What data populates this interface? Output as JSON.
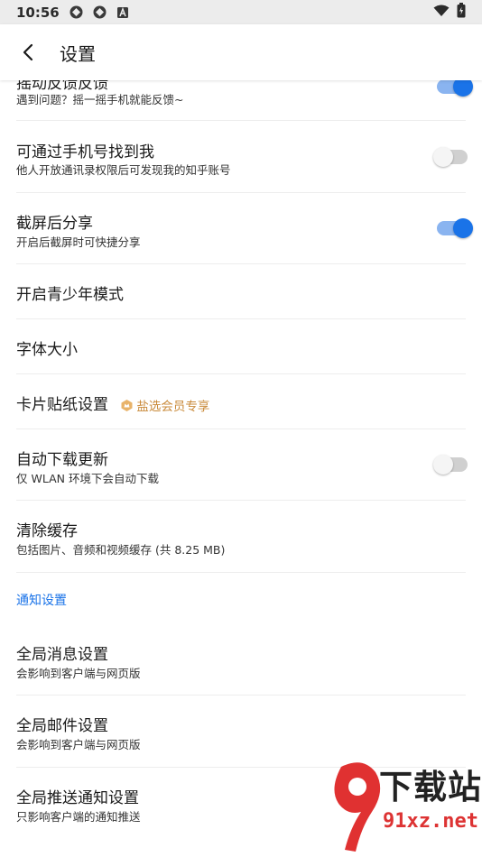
{
  "status_bar": {
    "time": "10:56",
    "icons": [
      "sync-icon",
      "sync-icon",
      "a-notification-icon"
    ],
    "right_icons": [
      "wifi-icon",
      "battery-icon"
    ]
  },
  "app_bar": {
    "title": "设置"
  },
  "settings": [
    {
      "title": "摇动反馈反馈",
      "subtitle": "遇到问题？摇一摇手机就能反馈~",
      "switch": true
    },
    {
      "title": "可通过手机号找到我",
      "subtitle": "他人开放通讯录权限后可发现我的知乎账号",
      "switch": false
    },
    {
      "title": "截屏后分享",
      "subtitle": "开启后截屏时可快捷分享",
      "switch": true
    },
    {
      "title": "开启青少年模式"
    },
    {
      "title": "字体大小"
    },
    {
      "title": "卡片贴纸设置",
      "badge": "盐选会员专享"
    },
    {
      "title": "自动下载更新",
      "subtitle": "仅 WLAN 环境下会自动下载",
      "switch": false
    },
    {
      "title": "清除缓存",
      "subtitle": "包括图片、音频和视频缓存 (共 8.25 MB)"
    }
  ],
  "notification_section": {
    "header": "通知设置",
    "items": [
      {
        "title": "全局消息设置",
        "subtitle": "会影响到客户端与网页版"
      },
      {
        "title": "全局邮件设置",
        "subtitle": "会影响到客户端与网页版"
      },
      {
        "title": "全局推送通知设置",
        "subtitle": "只影响客户端的通知推送"
      }
    ]
  },
  "watermark": {
    "text": "下载站",
    "domain": "91xz.net"
  },
  "colors": {
    "accent": "#1a73e8",
    "switch_track_on": "#8ab4f0",
    "badge": "#c98a3a"
  }
}
